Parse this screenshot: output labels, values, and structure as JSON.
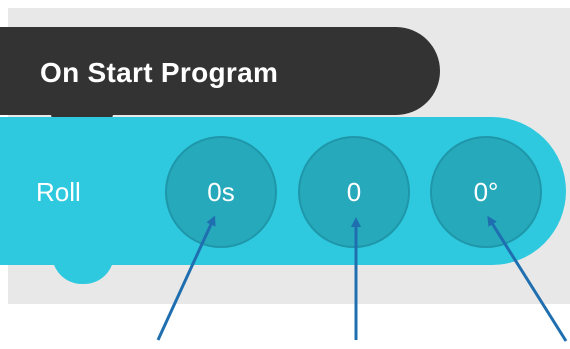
{
  "start_block": {
    "label": "On Start Program"
  },
  "roll_block": {
    "label": "Roll",
    "params": [
      {
        "value": "0s"
      },
      {
        "value": "0"
      },
      {
        "value": "0°"
      }
    ]
  },
  "colors": {
    "start_block": "#333333",
    "roll_block": "#2ec9de",
    "param_circle": "#27a9bc",
    "arrow": "#1f6fb0",
    "canvas": "#e8e8e8"
  }
}
